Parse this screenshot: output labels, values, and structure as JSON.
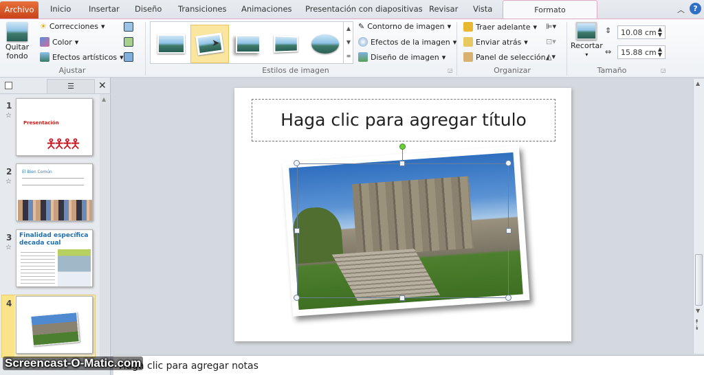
{
  "tabs": {
    "archivo": "Archivo",
    "items": [
      "Inicio",
      "Insertar",
      "Diseño",
      "Transiciones",
      "Animaciones",
      "Presentación con diapositivas",
      "Revisar",
      "Vista"
    ],
    "active": "Formato"
  },
  "ribbon": {
    "ajustar": {
      "quitar_fondo": "Quitar fondo",
      "correcciones": "Correcciones",
      "color": "Color",
      "efectos": "Efectos artísticos",
      "label": "Ajustar"
    },
    "estilos": {
      "contorno": "Contorno de imagen",
      "efectos": "Efectos de la imagen",
      "diseno": "Diseño de imagen",
      "label": "Estilos de imagen",
      "selected_index": 1
    },
    "organizar": {
      "traer": "Traer adelante",
      "enviar": "Enviar atrás",
      "panel": "Panel de selección",
      "label": "Organizar"
    },
    "tamano": {
      "recortar": "Recortar",
      "height": "10.08 cm",
      "width": "15.88 cm",
      "label": "Tamaño"
    }
  },
  "slides": [
    {
      "num": "1",
      "title": "Presentación"
    },
    {
      "num": "2",
      "title": "El Bien Común"
    },
    {
      "num": "3",
      "title": "Finalidad específica decada cual"
    },
    {
      "num": "4",
      "title": ""
    }
  ],
  "current_slide": 4,
  "slide": {
    "title_placeholder": "Haga clic para agregar título"
  },
  "notes": {
    "placeholder": "Haga clic para agregar notas"
  },
  "watermark": "Screencast-O-Matic.com",
  "colors": {
    "archivo": "#d2541f",
    "accent_tab_border": "#e2a7c4",
    "selected_thumb": "#f8e08a"
  }
}
